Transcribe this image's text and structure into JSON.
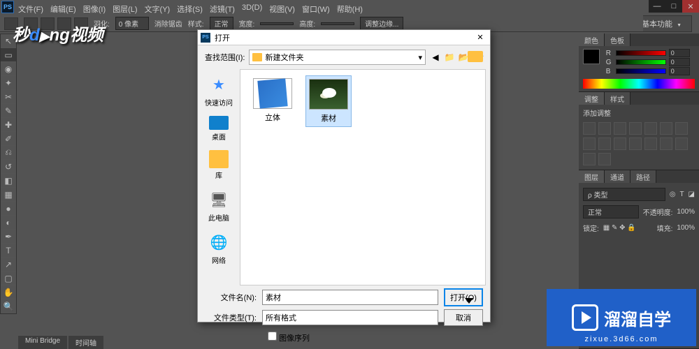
{
  "app": {
    "ps_label": "PS"
  },
  "menu": [
    "文件(F)",
    "编辑(E)",
    "图像(I)",
    "图层(L)",
    "文字(Y)",
    "选择(S)",
    "滤镜(T)",
    "3D(D)",
    "视图(V)",
    "窗口(W)",
    "帮助(H)"
  ],
  "workspace": "基本功能",
  "options": {
    "feather_label": "羽化:",
    "feather_value": "0 像素",
    "aa_label": "消除锯齿",
    "style_label": "样式:",
    "style_value": "正常",
    "width_label": "宽度:",
    "height_label": "高度:",
    "refine": "调整边缘..."
  },
  "logo": {
    "text1": "秒",
    "text2": "d",
    "text3": "ng视频",
    "play": "▶"
  },
  "bottom_tabs": [
    "Mini Bridge",
    "时间轴"
  ],
  "panels": {
    "color": {
      "tabs": [
        "颜色",
        "色板"
      ],
      "r": "0",
      "g": "0",
      "b": "0"
    },
    "adjust": {
      "tabs": [
        "调整",
        "样式"
      ],
      "title": "添加调整"
    },
    "layers": {
      "tabs": [
        "图层",
        "通道",
        "路径"
      ],
      "kind_label": "ρ 类型",
      "mode": "正常",
      "opacity_label": "不透明度:",
      "opacity_val": "100%",
      "lock_label": "锁定:",
      "fill_label": "填充:",
      "fill_val": "100%"
    }
  },
  "dialog": {
    "title": "打开",
    "lookin_label": "查找范围(I):",
    "lookin_value": "新建文件夹",
    "places": [
      {
        "label": "快速访问",
        "icon": "quick"
      },
      {
        "label": "桌面",
        "icon": "desktop"
      },
      {
        "label": "库",
        "icon": "lib"
      },
      {
        "label": "此电脑",
        "icon": "pc"
      },
      {
        "label": "网络",
        "icon": "net"
      }
    ],
    "files": [
      {
        "name": "立体",
        "type": "cube",
        "selected": false
      },
      {
        "name": "素材",
        "type": "flower",
        "selected": true
      }
    ],
    "filename_label": "文件名(N):",
    "filename_value": "素材",
    "filetype_label": "文件类型(T):",
    "filetype_value": "所有格式",
    "open_btn": "打开(O)",
    "cancel_btn": "取消",
    "sequence": "图像序列"
  },
  "brand": {
    "name": "溜溜自学",
    "url": "zixue.3d66.com"
  }
}
